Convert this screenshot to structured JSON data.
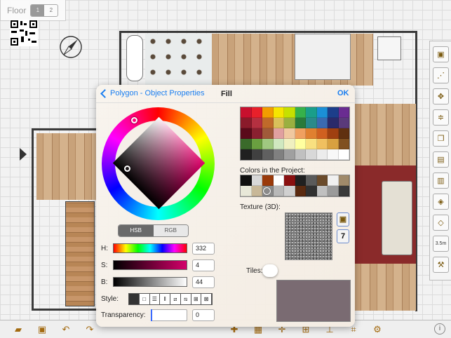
{
  "floor": {
    "label": "Floor",
    "buttons": [
      "1",
      "2"
    ],
    "selected": "1"
  },
  "dialog": {
    "back_label": "Polygon - Object Properties",
    "title": "Fill",
    "ok_label": "OK",
    "mode_tabs": [
      "HSB",
      "RGB"
    ],
    "mode_selected": "HSB",
    "sliders": [
      {
        "label": "H:",
        "value": "332"
      },
      {
        "label": "S:",
        "value": "4"
      },
      {
        "label": "B:",
        "value": "44"
      }
    ],
    "style_label": "Style:",
    "transparency_label": "Transparency:",
    "transparency_value": "0",
    "colors_project_label": "Colors in the Project:",
    "texture_label": "Texture (3D):",
    "tiles_label": "Tiles:",
    "palette": [
      "#c8102e",
      "#e8202a",
      "#f29c00",
      "#f6e500",
      "#c6e000",
      "#36b14a",
      "#1a9e8a",
      "#1b8fd6",
      "#1c3e8a",
      "#6a2c91",
      "#8a1a2a",
      "#b43040",
      "#c06a2a",
      "#d9c05a",
      "#9ab040",
      "#2a7a3a",
      "#2a8a8a",
      "#3a6ab0",
      "#2a2a6a",
      "#5a3a7a",
      "#5a0a1a",
      "#8a2030",
      "#a05a3a",
      "#e0a0a0",
      "#f0c8a0",
      "#f0a060",
      "#e08030",
      "#d06020",
      "#a04010",
      "#603010",
      "#3a6a2a",
      "#6aa040",
      "#a0c880",
      "#d0e8c0",
      "#f0f0c0",
      "#ffffa0",
      "#f8e080",
      "#f0c060",
      "#d8a040",
      "#805020",
      "#202020",
      "#404040",
      "#606060",
      "#808080",
      "#a0a0a0",
      "#c0c0c0",
      "#d8d8d8",
      "#ececec",
      "#f8f8f8",
      "#ffffff"
    ],
    "project_colors": [
      "#101010",
      "#d8d8d8",
      "#9a3a0a",
      "#ffffff",
      "#8a1010",
      "#202020",
      "#5a5a5a",
      "#6a4a2a",
      "#f0f0f0",
      "#a08a6a",
      "#e8e8d8",
      "#c8b898",
      "#8a8a8a",
      "#b8b8b8",
      "#d0d0d0",
      "#5a2a10",
      "#303030",
      "#c0c0c0",
      "#9a9a9a",
      "#3a3a3a"
    ],
    "preview_color": "#7a6b72"
  },
  "bottom_toolbar_icons": [
    "folder-icon",
    "save-icon",
    "undo-icon",
    "redo-icon",
    "add-object-icon",
    "pattern-icon",
    "cross-icon",
    "grid-icon",
    "level-icon",
    "crop-icon",
    "gear-icon"
  ],
  "right_toolbar_icons": [
    "texture-icon",
    "nodes-icon",
    "move-icon",
    "align-icon",
    "objects-icon",
    "lock-icon",
    "lock-open-icon",
    "cube-icon",
    "cube-stack-icon",
    "measure-icon",
    "wrench-icon"
  ],
  "right_toolbar_measure_label": "3.5m",
  "info_label": "i"
}
